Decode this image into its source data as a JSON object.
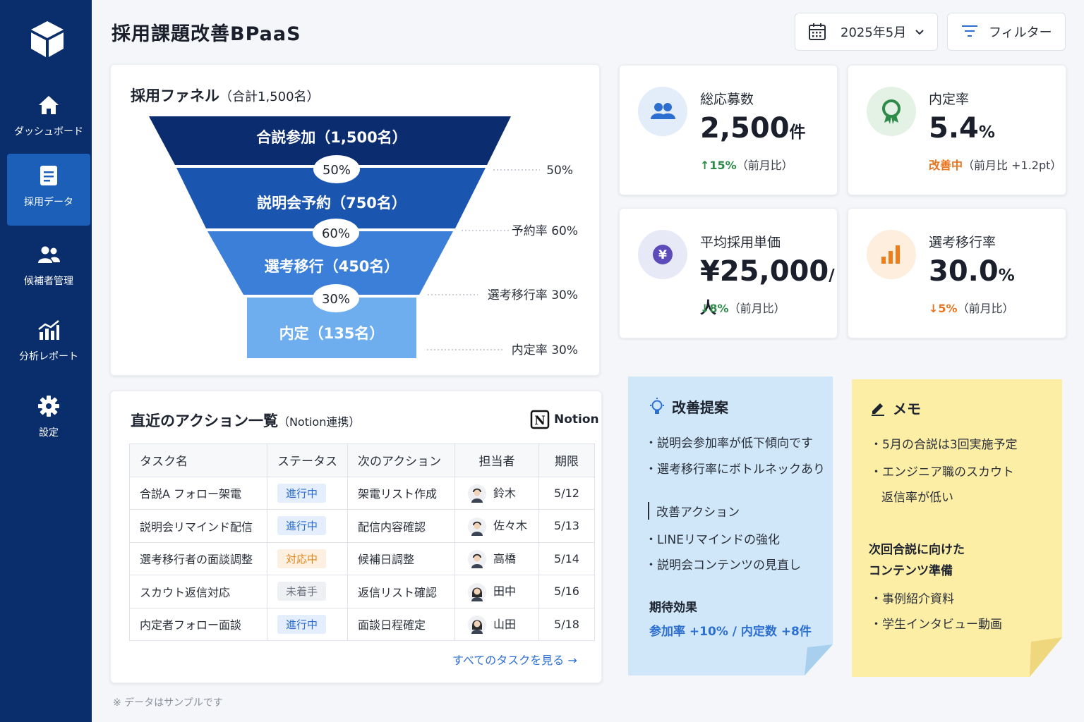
{
  "app": {
    "title": "採用課題改善BPaaS"
  },
  "sidebar": {
    "items": [
      {
        "label": "ダッシュボード",
        "icon": "home-icon"
      },
      {
        "label": "採用データ",
        "icon": "document-icon",
        "active": true
      },
      {
        "label": "候補者管理",
        "icon": "users-icon"
      },
      {
        "label": "分析レポート",
        "icon": "chart-icon"
      },
      {
        "label": "設定",
        "icon": "gear-icon"
      }
    ]
  },
  "header": {
    "month": "2025年5月",
    "filter": "フィルター"
  },
  "funnel": {
    "title": "採用ファネル",
    "subtitle": "（合計1,500名）",
    "stages": [
      {
        "label": "合説参加（1,500名）",
        "count": 1500,
        "color": "#0b2c6e"
      },
      {
        "label": "説明会予約（750名）",
        "count": 750,
        "color": "#1a56b0"
      },
      {
        "label": "選考移行（450名）",
        "count": 450,
        "color": "#3b7fd8"
      },
      {
        "label": "内定（135名）",
        "count": 135,
        "color": "#6faeee"
      }
    ],
    "bubbles": [
      "50%",
      "60%",
      "30%"
    ],
    "side_labels": [
      "50%",
      "予約率 60%",
      "選考移行率 30%",
      "内定率 30%"
    ]
  },
  "stats": [
    {
      "label": "総応募数",
      "value": "2,500",
      "unit": "件",
      "change_value": "15%",
      "change_arrow": "↑",
      "change_text": "（前月比）",
      "tone": "green",
      "icon": "users-icon"
    },
    {
      "label": "内定率",
      "value": "5.4",
      "unit": "%",
      "change_value": "改善中",
      "change_arrow": "",
      "change_text": "（前月比 +1.2pt）",
      "tone": "orange",
      "icon": "award-icon"
    },
    {
      "label": "平均採用単価",
      "value": "¥25,000",
      "unit": "/人",
      "change_value": "8%",
      "change_arrow": "↓",
      "change_text": "（前月比）",
      "tone": "green",
      "icon": "yen-icon"
    },
    {
      "label": "選考移行率",
      "value": "30.0",
      "unit": "%",
      "change_value": "5%",
      "change_arrow": "↓",
      "change_text": "（前月比）",
      "tone": "orange",
      "icon": "bar-chart-icon"
    }
  ],
  "actions": {
    "title": "直近のアクション一覧",
    "subtitle": "（Notion連携）",
    "notion": "Notion",
    "columns": [
      "タスク名",
      "ステータス",
      "次のアクション",
      "担当者",
      "期限"
    ],
    "rows": [
      {
        "task": "合説A フォロー架電",
        "status": "進行中",
        "tone": "blue",
        "next": "架電リスト作成",
        "owner": "鈴木",
        "due": "5/12"
      },
      {
        "task": "説明会リマインド配信",
        "status": "進行中",
        "tone": "blue",
        "next": "配信内容確認",
        "owner": "佐々木",
        "due": "5/13"
      },
      {
        "task": "選考移行者の面談調整",
        "status": "対応中",
        "tone": "orange",
        "next": "候補日調整",
        "owner": "高橋",
        "due": "5/14"
      },
      {
        "task": "スカウト返信対応",
        "status": "未着手",
        "tone": "gray",
        "next": "返信リスト確認",
        "owner": "田中",
        "due": "5/16"
      },
      {
        "task": "内定者フォロー面談",
        "status": "進行中",
        "tone": "blue",
        "next": "面談日程確定",
        "owner": "山田",
        "due": "5/18"
      }
    ],
    "see_all": "すべてのタスクを見る →"
  },
  "proposal": {
    "title": "改善提案",
    "points": [
      "・説明会参加率が低下傾向です",
      "・選考移行率にボトルネックあり"
    ],
    "action_title": "改善アクション",
    "actions": [
      "・LINEリマインドの強化",
      "・説明会コンテンツの見直し"
    ],
    "effect_title": "期待効果",
    "effect": "参加率 +10% / 内定数 +8件"
  },
  "memo": {
    "title": "メモ",
    "lines": [
      "・5月の合説は3回実施予定",
      "・エンジニア職のスカウト",
      "返信率が低い"
    ],
    "next_title_1": "次回合説に向けた",
    "next_title_2": "コンテンツ準備",
    "items": [
      "・事例紹介資料",
      "・学生インタビュー動画"
    ]
  },
  "footnote": "※ データはサンプルです"
}
